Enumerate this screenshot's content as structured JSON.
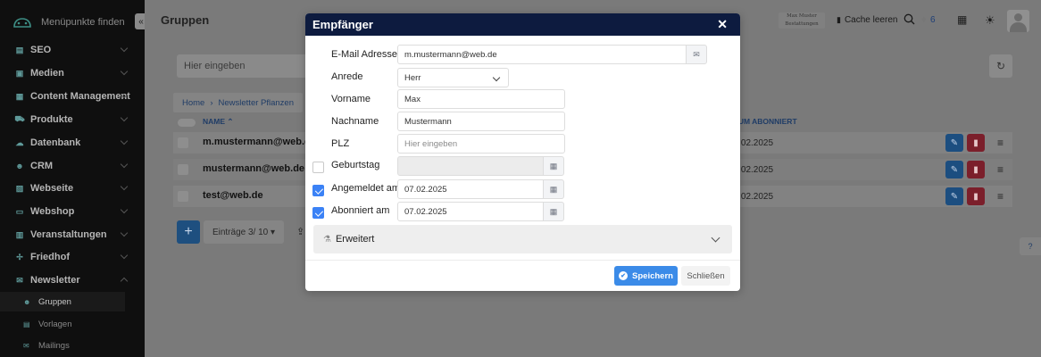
{
  "sidebar": {
    "search_placeholder": "Menüpunkte finden",
    "collapse_glyph": "«",
    "items": [
      {
        "label": "SEO",
        "icon": "seo-icon"
      },
      {
        "label": "Medien",
        "icon": "media-icon"
      },
      {
        "label": "Content Management",
        "icon": "content-icon"
      },
      {
        "label": "Produkte",
        "icon": "cart-icon"
      },
      {
        "label": "Datenbank",
        "icon": "database-icon"
      },
      {
        "label": "CRM",
        "icon": "users-icon"
      },
      {
        "label": "Webseite",
        "icon": "website-icon"
      },
      {
        "label": "Webshop",
        "icon": "shop-icon"
      },
      {
        "label": "Veranstaltungen",
        "icon": "calendar-icon"
      },
      {
        "label": "Friedhof",
        "icon": "cross-icon"
      },
      {
        "label": "Newsletter",
        "icon": "mail-icon"
      }
    ],
    "subitems": [
      {
        "label": "Gruppen",
        "icon": "group-icon",
        "active": true
      },
      {
        "label": "Vorlagen",
        "icon": "template-icon",
        "active": false
      },
      {
        "label": "Mailings",
        "icon": "mailing-icon",
        "active": false
      }
    ]
  },
  "header": {
    "page_title": "Gruppen",
    "logo_text": "Max Muster Bestattungen",
    "cache_label": "Cache leeren",
    "notification_count": "6"
  },
  "list": {
    "search_placeholder": "Hier eingeben",
    "breadcrumb": [
      "Home",
      "Newsletter Pflanzen"
    ],
    "col_name": "NAME",
    "col_date": "DATUM ABONNIERT",
    "rows": [
      {
        "email": "m.mustermann@web.de",
        "date": "07.02.2025"
      },
      {
        "email": "mustermann@web.de",
        "date": "07.02.2025"
      },
      {
        "email": "test@web.de",
        "date": "07.02.2025"
      }
    ],
    "add_glyph": "+",
    "entries_label": "Einträge 3/ 10"
  },
  "modal": {
    "title": "Empfänger",
    "close_glyph": "✕",
    "fields": {
      "email_label": "E-Mail Adresse*",
      "email_value": "m.mustermann@web.de",
      "salutation_label": "Anrede",
      "salutation_value": "Herr",
      "firstname_label": "Vorname",
      "firstname_value": "Max",
      "lastname_label": "Nachname",
      "lastname_value": "Mustermann",
      "zip_label": "PLZ",
      "zip_placeholder": "Hier eingeben",
      "birthday_label": "Geburtstag",
      "birthday_checked": false,
      "registered_label": "Angemeldet am",
      "registered_value": "07.02.2025",
      "registered_checked": true,
      "subscribed_label": "Abonniert am",
      "subscribed_value": "07.02.2025",
      "subscribed_checked": true
    },
    "advanced_label": "Erweitert",
    "save_label": "Speichern",
    "cancel_label": "Schließen"
  },
  "colors": {
    "modal_header": "#0d1b3f",
    "primary": "#3b8be8",
    "checkbox": "#3b82f6",
    "sidebar_bg": "#0f0f0f",
    "overlay": "#7a7a7a"
  }
}
